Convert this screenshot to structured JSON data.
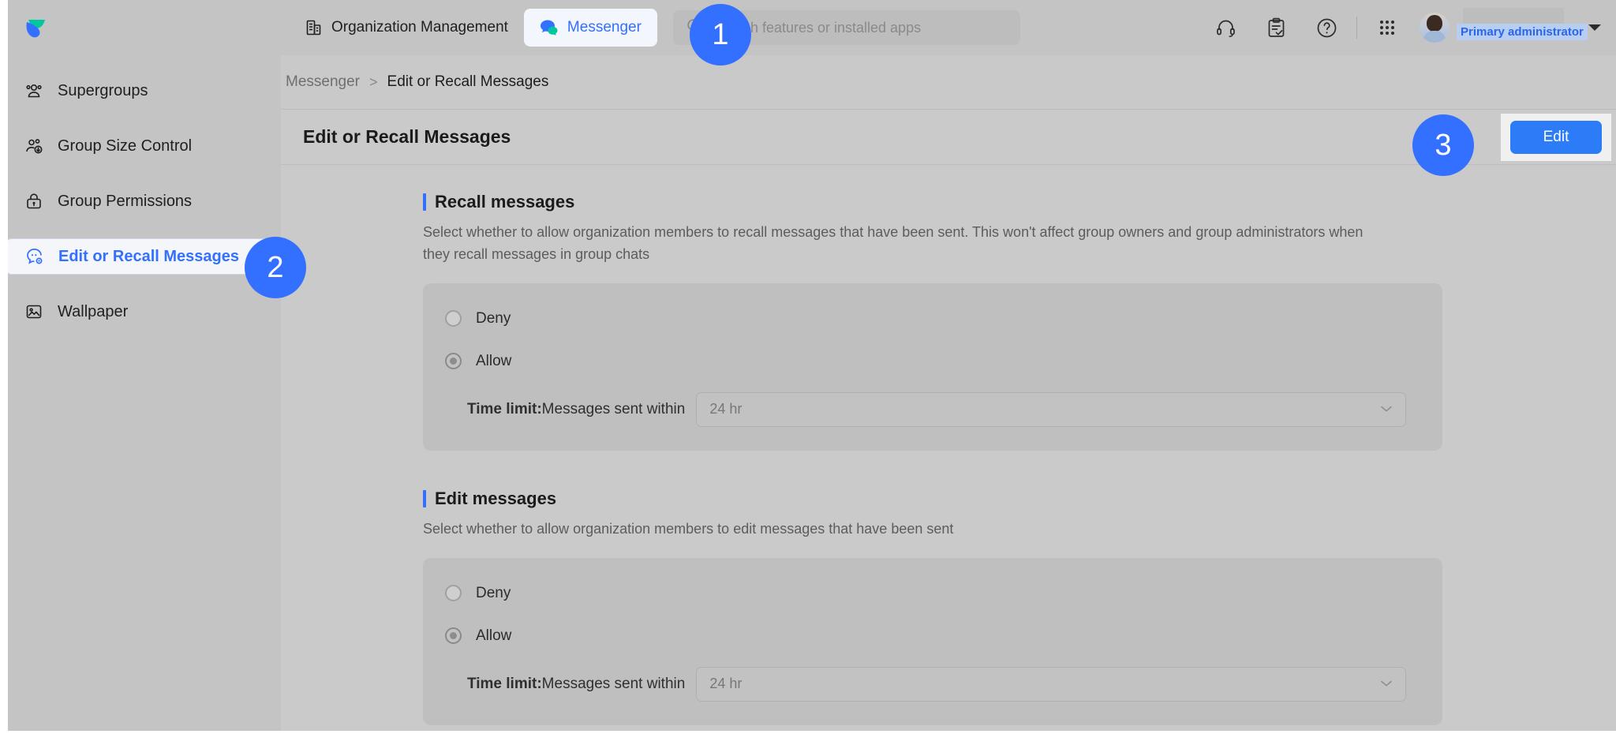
{
  "header": {
    "logo_icon": "lark-bird-logo",
    "nav": [
      {
        "label": "Organization Management",
        "icon": "building-icon",
        "active": false
      },
      {
        "label": "Messenger",
        "icon": "messenger-bubbles-icon",
        "active": true
      }
    ],
    "search": {
      "placeholder": "Search features or installed apps",
      "icon": "search-icon"
    },
    "actions": [
      {
        "name": "support-headset-icon"
      },
      {
        "name": "clipboard-check-icon"
      },
      {
        "name": "help-question-icon"
      },
      {
        "name": "apps-grid-icon"
      }
    ],
    "user": {
      "role_badge": "Primary administrator",
      "avatar": "user-avatar",
      "caret": "chevron-down-icon"
    }
  },
  "sidebar": {
    "items": [
      {
        "label": "Supergroups",
        "icon": "supergroups-icon",
        "active": false
      },
      {
        "label": "Group Size Control",
        "icon": "group-size-icon",
        "active": false
      },
      {
        "label": "Group Permissions",
        "icon": "lock-permissions-icon",
        "active": false
      },
      {
        "label": "Edit or Recall Messages",
        "icon": "edit-recall-icon",
        "active": true
      },
      {
        "label": "Wallpaper",
        "icon": "wallpaper-image-icon",
        "active": false
      }
    ]
  },
  "breadcrumb": {
    "parent": "Messenger",
    "separator": ">",
    "current": "Edit or Recall Messages"
  },
  "panel": {
    "title": "Edit or Recall Messages",
    "edit_button": "Edit"
  },
  "sections": [
    {
      "title": "Recall messages",
      "description": "Select whether to allow organization members to recall messages that have been sent. This won't affect group owners and group administrators when they recall messages in group chats",
      "options": [
        {
          "label": "Deny",
          "checked": false
        },
        {
          "label": "Allow",
          "checked": true
        }
      ],
      "time_limit": {
        "label_bold": "Time limit:",
        "label_rest": "Messages sent within",
        "value": "24 hr",
        "chevron": "chevron-down-icon"
      }
    },
    {
      "title": "Edit messages",
      "description": "Select whether to allow organization members to edit messages that have been sent",
      "options": [
        {
          "label": "Deny",
          "checked": false
        },
        {
          "label": "Allow",
          "checked": true
        }
      ],
      "time_limit": {
        "label_bold": "Time limit:",
        "label_rest": "Messages sent within",
        "value": "24 hr",
        "chevron": "chevron-down-icon"
      }
    }
  ],
  "step_badges": [
    {
      "number": "1"
    },
    {
      "number": "2"
    },
    {
      "number": "3"
    }
  ],
  "colors": {
    "accent": "#3370ff",
    "button": "#2b7cf6",
    "page_bg": "#c4c4c4",
    "panel_bg": "#cacaca",
    "card_bg": "#bfbfbf"
  }
}
